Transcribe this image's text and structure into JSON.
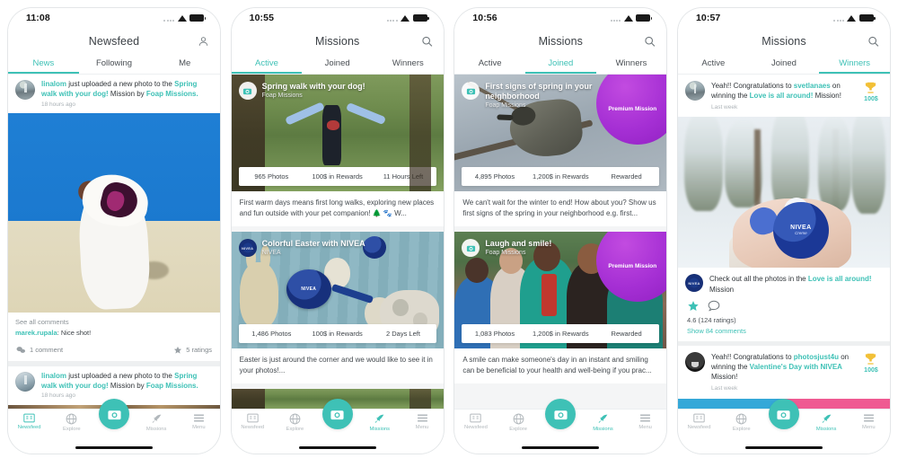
{
  "theme": {
    "accent": "#3ec1b6",
    "premium": "#a52fd4",
    "trophy": "#f2c037"
  },
  "phones": [
    {
      "status": {
        "time": "11:08"
      },
      "nav": {
        "title": "Newsfeed",
        "action_icon": "person-icon"
      },
      "tabs": [
        {
          "label": "News",
          "active": true
        },
        {
          "label": "Following",
          "active": false
        },
        {
          "label": "Me",
          "active": false
        }
      ],
      "feed": [
        {
          "user": "linalom",
          "text_1": " just uploaded a new photo to the ",
          "mission": "Spring walk with your dog!",
          "text_2": " Mission by ",
          "brand": "Foap Missions.",
          "time": "18 hours ago",
          "comments_link": "See all comments",
          "comment_user": "marek.rupala",
          "comment_text": ": Nice shot!",
          "comment_count": "1 comment",
          "ratings": "5 ratings"
        },
        {
          "user": "linalom",
          "text_1": " just uploaded a new photo to the ",
          "mission": "Spring walk with your dog!",
          "text_2": " Mission by ",
          "brand": "Foap Missions.",
          "time": "18 hours ago"
        }
      ],
      "tabbar": [
        {
          "label": "Newsfeed",
          "icon": "newsfeed-icon",
          "active": true
        },
        {
          "label": "Explore",
          "icon": "globe-icon",
          "active": false
        },
        {
          "label": "Missions",
          "icon": "rocket-icon",
          "active": false
        },
        {
          "label": "Menu",
          "icon": "hamburger-icon",
          "active": false
        }
      ],
      "camera_button": "camera-icon"
    },
    {
      "status": {
        "time": "10:55"
      },
      "nav": {
        "title": "Missions",
        "action_icon": "search-icon"
      },
      "tabs": [
        {
          "label": "Active",
          "active": true
        },
        {
          "label": "Joined",
          "active": false
        },
        {
          "label": "Winners",
          "active": false
        }
      ],
      "missions": [
        {
          "title": "Spring walk with your dog!",
          "brand": "Foap Missions",
          "premium": false,
          "photos": "965 Photos",
          "rewards": "100$ in Rewards",
          "status": "11 Hours Left",
          "description": "First warm days means first long walks, exploring new places and fun outside with your pet companion! 🌲 🐾 W..."
        },
        {
          "title": "Colorful Easter with NIVEA",
          "brand": "NIVEA",
          "premium": false,
          "photos": "1,486 Photos",
          "rewards": "100$ in Rewards",
          "status": "2 Days Left",
          "description": "Easter is just around the corner and we would like to see it in your photos!..."
        }
      ],
      "tabbar": [
        {
          "label": "Newsfeed",
          "icon": "newsfeed-icon",
          "active": false
        },
        {
          "label": "Explore",
          "icon": "globe-icon",
          "active": false
        },
        {
          "label": "Missions",
          "icon": "rocket-icon",
          "active": true
        },
        {
          "label": "Menu",
          "icon": "hamburger-icon",
          "active": false
        }
      ],
      "camera_button": "camera-icon"
    },
    {
      "status": {
        "time": "10:56"
      },
      "nav": {
        "title": "Missions",
        "action_icon": "search-icon"
      },
      "tabs": [
        {
          "label": "Active",
          "active": false
        },
        {
          "label": "Joined",
          "active": true
        },
        {
          "label": "Winners",
          "active": false
        }
      ],
      "missions": [
        {
          "title": "First signs of spring in your neighborhood",
          "brand": "Foap Missions",
          "premium": true,
          "premium_label": "Premium Mission",
          "photos": "4,895 Photos",
          "rewards": "1,200$ in Rewards",
          "status": "Rewarded",
          "description": "We can't wait for the winter to end! How about you? Show us first signs of the spring in your neighborhood e.g. first..."
        },
        {
          "title": "Laugh and smile!",
          "brand": "Foap Missions",
          "premium": true,
          "premium_label": "Premium Mission",
          "photos": "1,083 Photos",
          "rewards": "1,200$ in Rewards",
          "status": "Rewarded",
          "description": "A smile can make someone's day in an instant and smiling can be beneficial to your health and well-being if you prac..."
        }
      ],
      "tabbar": [
        {
          "label": "Newsfeed",
          "icon": "newsfeed-icon",
          "active": false
        },
        {
          "label": "Explore",
          "icon": "globe-icon",
          "active": false
        },
        {
          "label": "Missions",
          "icon": "rocket-icon",
          "active": true
        },
        {
          "label": "Menu",
          "icon": "hamburger-icon",
          "active": false
        }
      ],
      "camera_button": "camera-icon"
    },
    {
      "status": {
        "time": "10:57"
      },
      "nav": {
        "title": "Missions",
        "action_icon": "search-icon"
      },
      "tabs": [
        {
          "label": "Active",
          "active": false
        },
        {
          "label": "Joined",
          "active": false
        },
        {
          "label": "Winners",
          "active": true
        }
      ],
      "winners": [
        {
          "text_1": "Yeah!! Congratulations to ",
          "user": "svetlanaes",
          "text_2": " on winning the ",
          "mission": "Love is all around!",
          "text_3": " Mission!",
          "time": "Last week",
          "amount": "100$"
        },
        {
          "text_1": "Yeah!! Congratulations to ",
          "user": "photosjust4u",
          "text_2": " on winning the ",
          "mission": "Valentine's Day with NIVEA",
          "text_3": " Mission!",
          "time": "Last week",
          "amount": "100$"
        }
      ],
      "winner_post": {
        "caption_1": "Check out all the photos in the ",
        "caption_link": "Love is all around!",
        "caption_2": " Mission",
        "rating": "4.6 (124 ratings)",
        "comments": "Show 84 comments"
      },
      "tabbar": [
        {
          "label": "Newsfeed",
          "icon": "newsfeed-icon",
          "active": false
        },
        {
          "label": "Explore",
          "icon": "globe-icon",
          "active": false
        },
        {
          "label": "Missions",
          "icon": "rocket-icon",
          "active": true
        },
        {
          "label": "Menu",
          "icon": "hamburger-icon",
          "active": false
        }
      ],
      "camera_button": "camera-icon"
    }
  ]
}
